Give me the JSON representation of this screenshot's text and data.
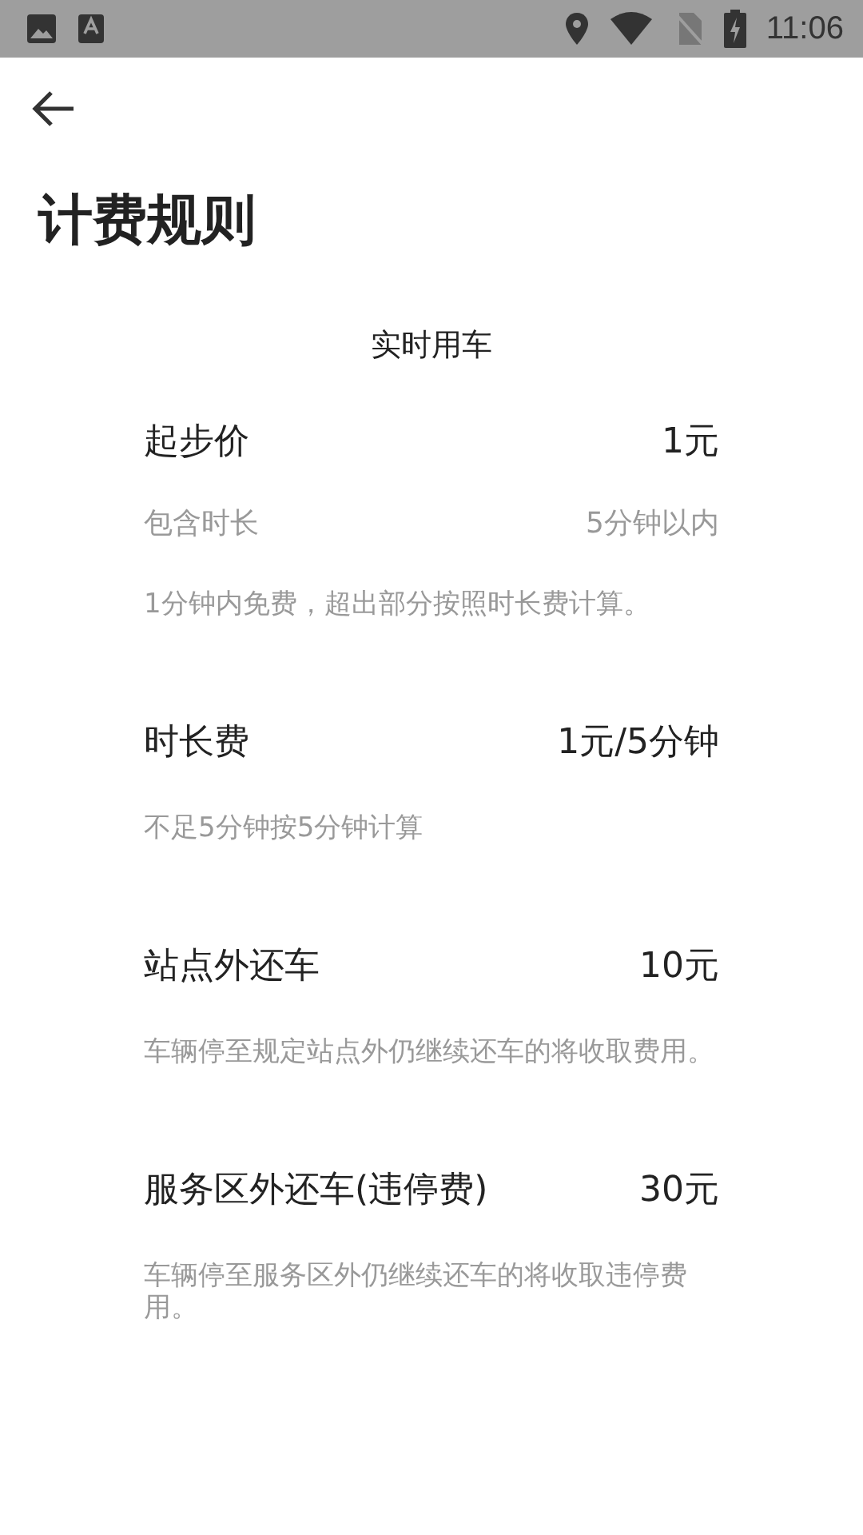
{
  "status_bar": {
    "time": "11:06"
  },
  "title": "计费规则",
  "section": "实时用车",
  "rules": [
    {
      "name": "起步价",
      "price": "1元",
      "details": [
        {
          "label": "包含时长",
          "value": "5分钟以内"
        }
      ],
      "note": "1分钟内免费，超出部分按照时长费计算。"
    },
    {
      "name": "时长费",
      "price": "1元/5分钟",
      "note": "不足5分钟按5分钟计算"
    },
    {
      "name": "站点外还车",
      "price": "10元",
      "note": "车辆停至规定站点外仍继续还车的将收取费用。"
    },
    {
      "name": "服务区外还车(违停费)",
      "price": "30元",
      "note": "车辆停至服务区外仍继续还车的将收取违停费用。"
    }
  ]
}
